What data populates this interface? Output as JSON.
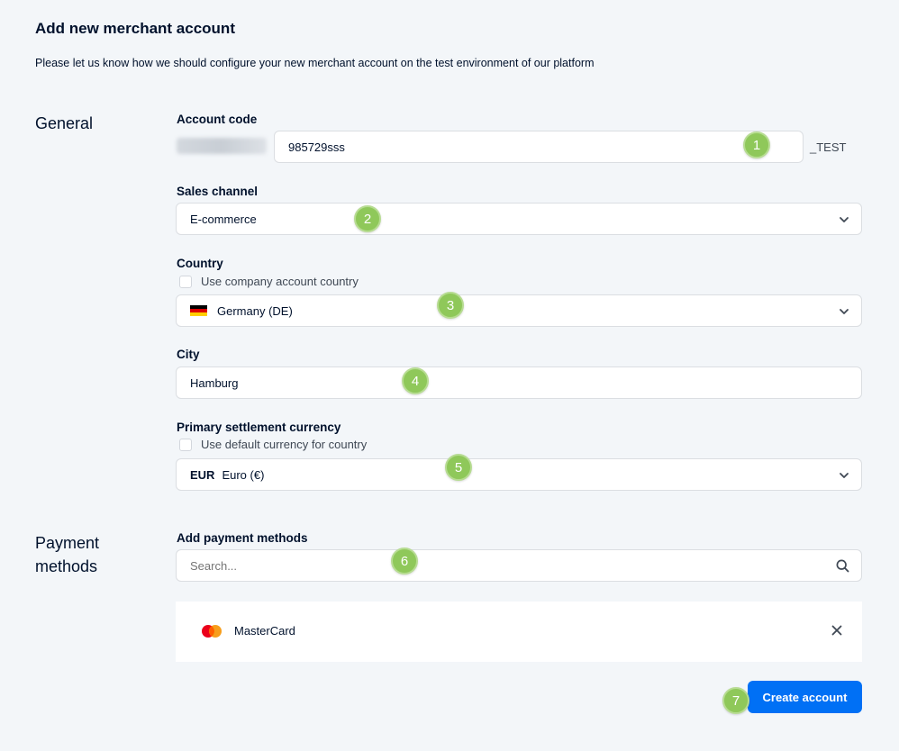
{
  "header": {
    "title": "Add new merchant account",
    "subtitle": "Please let us know how we should configure your new merchant account on the test environment of our platform"
  },
  "sections": {
    "general": "General",
    "payment_methods_line1": "Payment",
    "payment_methods_line2": "methods"
  },
  "account_code": {
    "label": "Account code",
    "value": "985729sss",
    "suffix": "_TEST"
  },
  "sales_channel": {
    "label": "Sales channel",
    "value": "E-commerce"
  },
  "country": {
    "label": "Country",
    "checkbox_label": "Use company account country",
    "value": "Germany (DE)",
    "flag_colors": [
      "#000000",
      "#dd0000",
      "#ffce00"
    ]
  },
  "city": {
    "label": "City",
    "value": "Hamburg"
  },
  "currency": {
    "label": "Primary settlement currency",
    "checkbox_label": "Use default currency for country",
    "code": "EUR",
    "name": "Euro (€)"
  },
  "payment_methods": {
    "label": "Add payment methods",
    "search_placeholder": "Search...",
    "items": [
      {
        "name": "MasterCard",
        "icon": "mastercard-icon"
      }
    ]
  },
  "actions": {
    "create_label": "Create account"
  },
  "badges": [
    "1",
    "2",
    "3",
    "4",
    "5",
    "6",
    "7"
  ],
  "colors": {
    "background": "#f3f6f9",
    "primary_button": "#0070f5",
    "badge": "#8fc85a",
    "text": "#00112c"
  }
}
